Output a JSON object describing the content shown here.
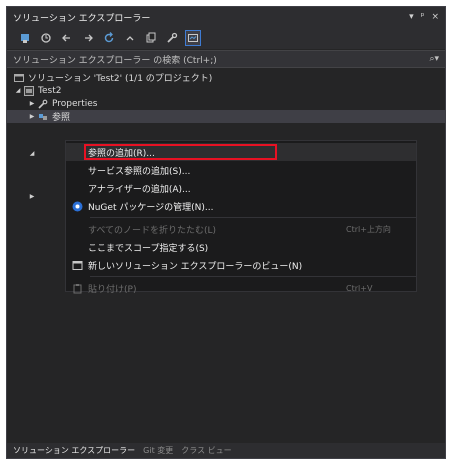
{
  "panel": {
    "title": "ソリューション エクスプローラー",
    "controls": [
      "▾",
      "ᵖ",
      "×"
    ]
  },
  "toolbar": {
    "icons": [
      "home-icon",
      "sync-history-icon",
      "back-icon",
      "forward-icon",
      "refresh-icon",
      "collapse-icon",
      "copy-icon",
      "wrench-icon",
      "preview-icon"
    ]
  },
  "search": {
    "placeholder": "ソリューション エクスプローラー の検索 (Ctrl+;)",
    "icon": "search-icon"
  },
  "tree": {
    "solution_label": "ソリューション 'Test2' (1/1 のプロジェクト)",
    "project_label": "Test2",
    "properties_label": "Properties",
    "references_label": "参照"
  },
  "context_menu": {
    "items": [
      {
        "label": "参照の追加(R)...",
        "shortcut": "",
        "icon": "",
        "disabled": false
      },
      {
        "label": "サービス参照の追加(S)...",
        "shortcut": "",
        "icon": "",
        "disabled": false
      },
      {
        "label": "アナライザーの追加(A)...",
        "shortcut": "",
        "icon": "",
        "disabled": false
      },
      {
        "label": "NuGet パッケージの管理(N)...",
        "shortcut": "",
        "icon": "nuget-icon",
        "disabled": false
      },
      {
        "label": "すべてのノードを折りたたむ(L)",
        "shortcut": "Ctrl+上方向",
        "icon": "",
        "disabled": true
      },
      {
        "label": "ここまでスコープ指定する(S)",
        "shortcut": "",
        "icon": "",
        "disabled": false
      },
      {
        "label": "新しいソリューション エクスプローラーのビュー(N)",
        "shortcut": "",
        "icon": "new-view-icon",
        "disabled": false
      },
      {
        "label": "貼り付け(P)",
        "shortcut": "Ctrl+V",
        "icon": "paste-icon",
        "disabled": true
      }
    ]
  },
  "bottom_tabs": [
    "ソリューション エクスプローラー",
    "Git 変更",
    "クラス ビュー"
  ],
  "colors": {
    "panel_bg": "#252526",
    "menu_bg": "#1b1b1c",
    "highlight": "#e81123",
    "accent": "#3e7bd3"
  }
}
